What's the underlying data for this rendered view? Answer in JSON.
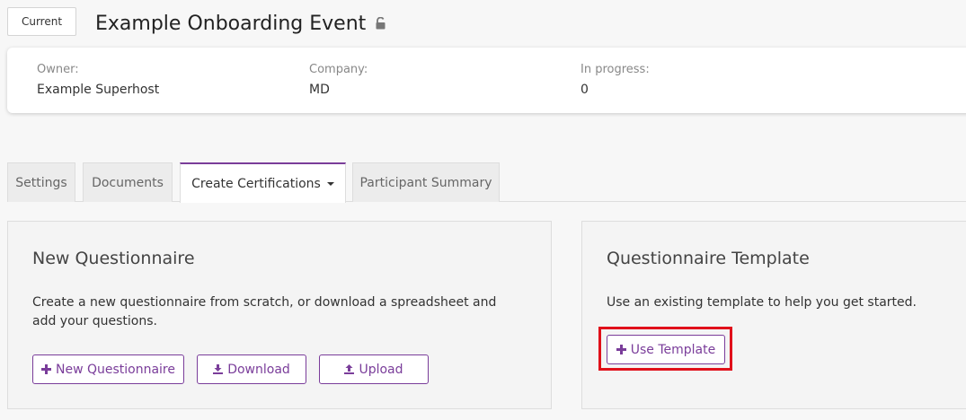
{
  "header": {
    "status_label": "Current",
    "title": "Example Onboarding Event"
  },
  "info": {
    "owner_label": "Owner:",
    "owner_value": "Example Superhost",
    "company_label": "Company:",
    "company_value": "MD",
    "progress_label": "In progress:",
    "progress_value": "0"
  },
  "tabs": [
    {
      "label": "Settings"
    },
    {
      "label": "Documents"
    },
    {
      "label": "Create Certifications",
      "active": true
    },
    {
      "label": "Participant Summary"
    }
  ],
  "new_questionnaire": {
    "title": "New Questionnaire",
    "description": "Create a new questionnaire from scratch, or download a spreadsheet and add your questions.",
    "new_button": "New Questionnaire",
    "download_button": "Download",
    "upload_button": "Upload"
  },
  "template": {
    "title": "Questionnaire Template",
    "description": "Use an existing template to help you get started.",
    "use_button": "Use Template"
  },
  "colors": {
    "accent": "#7a3d9a",
    "highlight": "#e0101a"
  }
}
